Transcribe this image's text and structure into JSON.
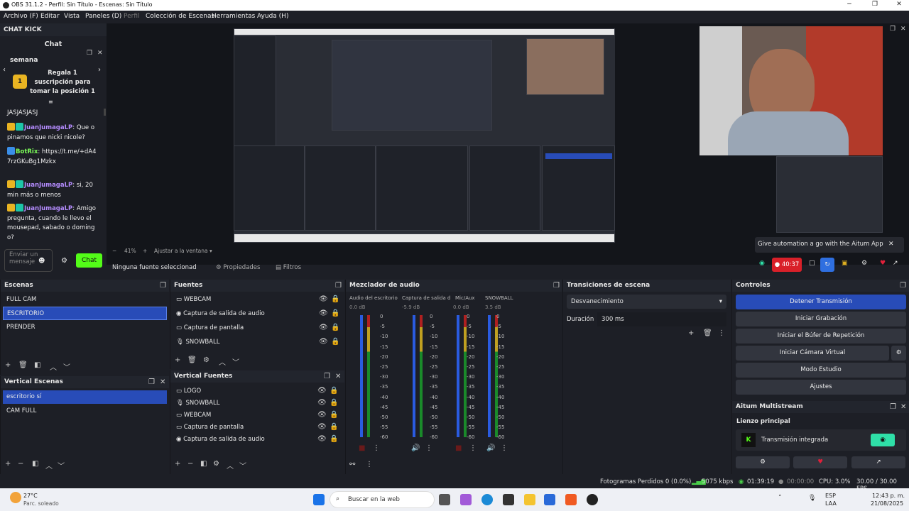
{
  "window": {
    "title": "OBS 31.1.2 - Perfil: Sin Título - Escenas: Sin Título"
  },
  "menu": [
    "Archivo (F)",
    "Editar",
    "Vista",
    "Paneles (D)",
    "Perfil",
    "Colección de Escenas",
    "Herramientas",
    "Ayuda (H)"
  ],
  "chat": {
    "dock_title": "CHAT KICK",
    "title": "Chat",
    "semana": "semana",
    "reward_text": "Regala 1 suscripción para tomar la posición 1",
    "lines": [
      {
        "user": "",
        "text": "JASJASJASJ"
      },
      {
        "user": "JuanJumagaLP",
        "text": ": Que opinamos que nicki nicole?"
      },
      {
        "user": "BotRix",
        "text": ": https://t.me/+dA47rzGKuBg1Mzkx",
        "bot": true
      },
      {
        "user": "JuanJumagaLP",
        "text": ": si, 20 min más o menos"
      },
      {
        "user": "JuanJumagaLP",
        "text": ": Amigo pregunta, cuando le llevo el mousepad, sabado o domingo?"
      }
    ],
    "input_placeholder": "Enviar un mensaje",
    "send": "Chat"
  },
  "preview": {
    "zoom": "41%",
    "fit": "Ajustar a la ventana"
  },
  "aitum_tip": "Give automation a go with the Aitum App",
  "rec_time": "40:37",
  "sourcebar": {
    "none": "Ninguna fuente seleccionad",
    "props": "Propiedades",
    "filters": "Filtros"
  },
  "scenes": {
    "title": "Escenas",
    "items": [
      "FULL CAM",
      "ESCRITORIO",
      "PRENDER"
    ],
    "selected": 1
  },
  "sources": {
    "title": "Fuentes",
    "items": [
      "WEBCAM",
      "Captura de salida de audio",
      "Captura de pantalla",
      "SNOWBALL"
    ]
  },
  "vscenes": {
    "title": "Vertical Escenas",
    "items": [
      "escritorio sí",
      "CAM FULL"
    ],
    "selected": 0
  },
  "vsources": {
    "title": "Vertical Fuentes",
    "items": [
      "LOGO",
      "SNOWBALL",
      "WEBCAM",
      "Captura de pantalla",
      "Captura de salida de audio"
    ]
  },
  "mixer": {
    "title": "Mezclador de audio",
    "channels": [
      {
        "name": "Audio del escritorio",
        "db": "0.0 dB"
      },
      {
        "name": "Captura de salida d",
        "db": "-5.9 dB"
      },
      {
        "name": "Mic/Aux",
        "db": "0.0 dB"
      },
      {
        "name": "SNOWBALL",
        "db": "3.5 dB"
      }
    ],
    "scale": [
      "0",
      "-5",
      "-10",
      "-15",
      "-20",
      "-25",
      "-30",
      "-35",
      "-40",
      "-45",
      "-50",
      "-55",
      "-60"
    ]
  },
  "transitions": {
    "title": "Transiciones de escena",
    "type": "Desvanecimiento",
    "duration_label": "Duración",
    "duration": "300 ms"
  },
  "controls": {
    "title": "Controles",
    "buttons": [
      "Detener Transmisión",
      "Iniciar Grabación",
      "Iniciar el Búfer de Repetición",
      "Iniciar Cámara Virtual",
      "Modo Estudio",
      "Ajustes"
    ]
  },
  "aitum": {
    "title": "Aitum Multistream",
    "canvas": "Lienzo principal",
    "output": "Transmisión integrada"
  },
  "status": {
    "dropped": "Fotogramas Perdidos 0 (0.0%)",
    "kbps": "5075 kbps",
    "live": "01:39:19",
    "rec": "00:00:00",
    "cpu": "CPU: 3.0%",
    "fps": "30.00 / 30.00 FPS"
  },
  "taskbar": {
    "temp": "27°C",
    "weather": "Parc. soleado",
    "search": "Buscar en la web",
    "lang1": "ESP",
    "lang2": "LAA",
    "time": "12:43 p. m.",
    "date": "21/08/2025"
  }
}
